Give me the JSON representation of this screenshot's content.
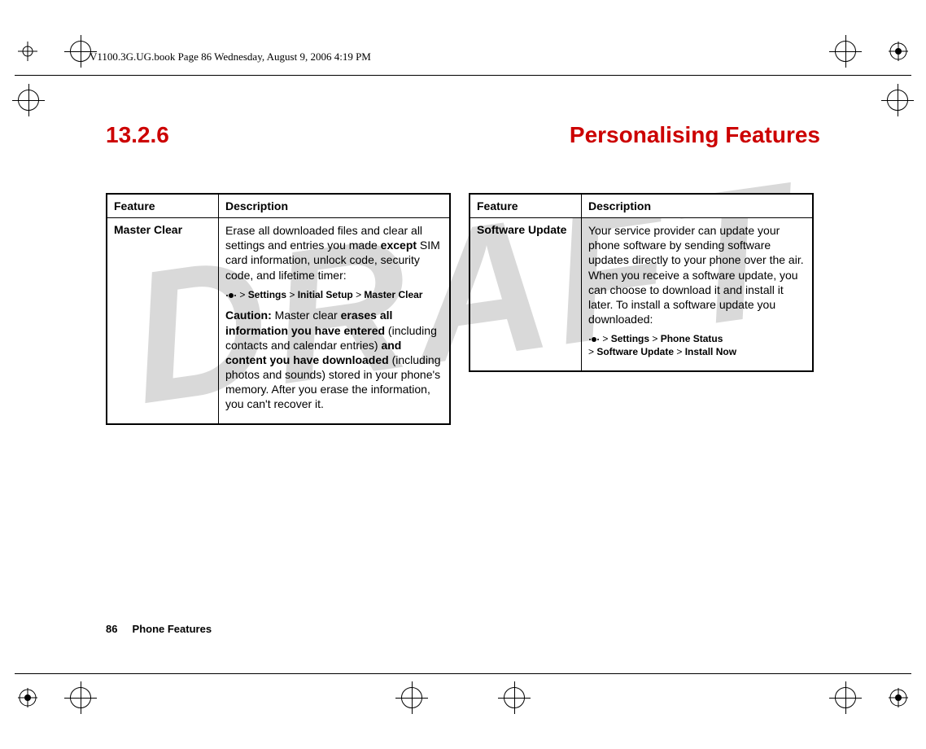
{
  "header_line": "V1100.3G.UG.book  Page 86  Wednesday, August 9, 2006  4:19 PM",
  "watermark": "DRAFT",
  "section_number": "13.2.6",
  "section_title": "Personalising Features",
  "columns": {
    "left": {
      "headers": {
        "feature": "Feature",
        "description": "Description"
      },
      "row": {
        "feature": "Master Clear",
        "intro_pre": "Erase all downloaded files and clear all settings and entries you made ",
        "intro_bold": "except",
        "intro_post": " SIM card information, unlock code, security code, and lifetime timer:",
        "path_parts": {
          "gt1": " > ",
          "p1": "Settings",
          "gt2": " > ",
          "p2": "Initial Setup",
          "gt3": " > ",
          "p3": "Master Clear"
        },
        "caution_label": "Caution:",
        "caution_pre": " Master clear ",
        "caution_b1": "erases all information you have entered",
        "caution_mid": " (including contacts and calendar entries) ",
        "caution_b2": "and content you have downloaded",
        "caution_post": " (including photos and sounds) stored in your phone's memory. After you erase the information, you can't recover it."
      }
    },
    "right": {
      "headers": {
        "feature": "Feature",
        "description": "Description"
      },
      "row": {
        "feature": "Software Update",
        "intro": "Your service provider can update your phone software by sending software updates directly to your phone over the air. When you receive a software update, you can choose to download it and install it later. To install a software update you downloaded:",
        "path_parts": {
          "gt1": " > ",
          "p1": "Settings",
          "gt2": " > ",
          "p2": "Phone Status",
          "br": "",
          "gt3": "> ",
          "p3": "Software Update",
          "gt4": " > ",
          "p4": "Install Now"
        }
      }
    }
  },
  "footer": {
    "page": "86",
    "label": "Phone Features"
  }
}
